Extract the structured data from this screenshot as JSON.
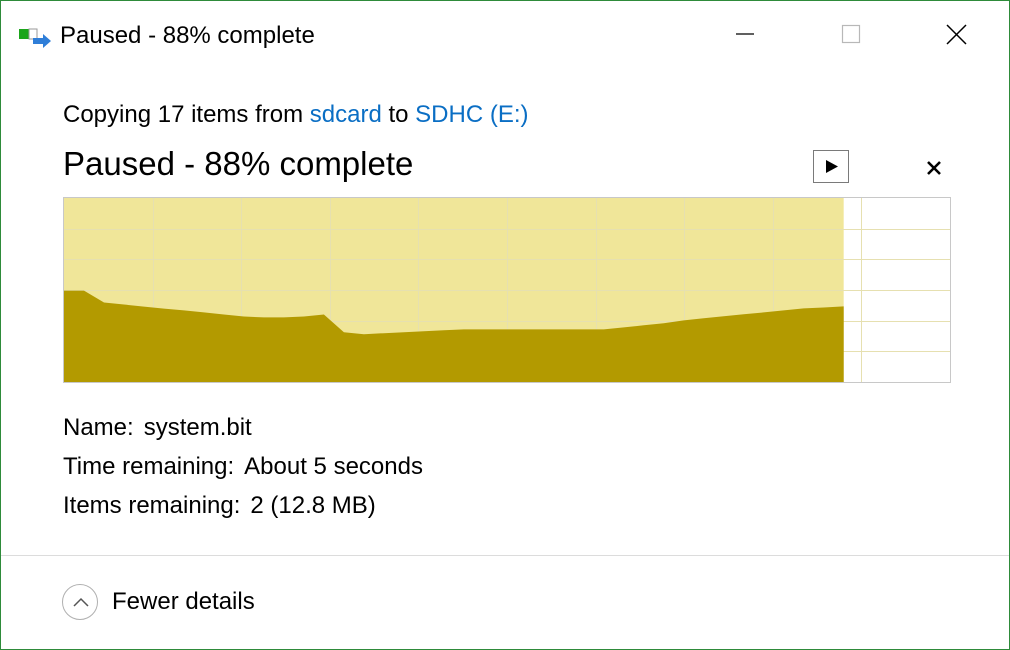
{
  "window": {
    "title": "Paused - 88% complete",
    "accent_color": "#2e8b3a",
    "app_icon": "file-copy-icon"
  },
  "copy_info": {
    "prefix": "Copying 17 items from ",
    "source": "sdcard",
    "middle": " to ",
    "destination": "SDHC (E:)",
    "link_color": "#0a6ec4"
  },
  "status": {
    "text": "Paused - 88% complete",
    "progress_percent": 88
  },
  "controls": {
    "resume_icon": "play-icon",
    "cancel_icon": "close-icon"
  },
  "speed_graph": {
    "progress_fill_color": "#f0e699",
    "speed_fill_color": "#b39a00",
    "grid_color": "#e6e0b0",
    "speed_profile": [
      0.497,
      0.497,
      0.432,
      0.421,
      0.41,
      0.399,
      0.389,
      0.378,
      0.367,
      0.356,
      0.351,
      0.351,
      0.356,
      0.367,
      0.27,
      0.259,
      0.265,
      0.27,
      0.276,
      0.281,
      0.286,
      0.286,
      0.286,
      0.286,
      0.286,
      0.286,
      0.286,
      0.286,
      0.297,
      0.308,
      0.319,
      0.335,
      0.346,
      0.357,
      0.368,
      0.378,
      0.389,
      0.4,
      0.405,
      0.411
    ]
  },
  "details": {
    "name_label": "Name:",
    "name_value": "system.bit",
    "time_label": "Time remaining:",
    "time_value": "About 5 seconds",
    "items_label": "Items remaining:",
    "items_value": "2 (12.8 MB)"
  },
  "footer": {
    "toggle_label": "Fewer details",
    "toggle_icon": "chevron-up-icon"
  }
}
